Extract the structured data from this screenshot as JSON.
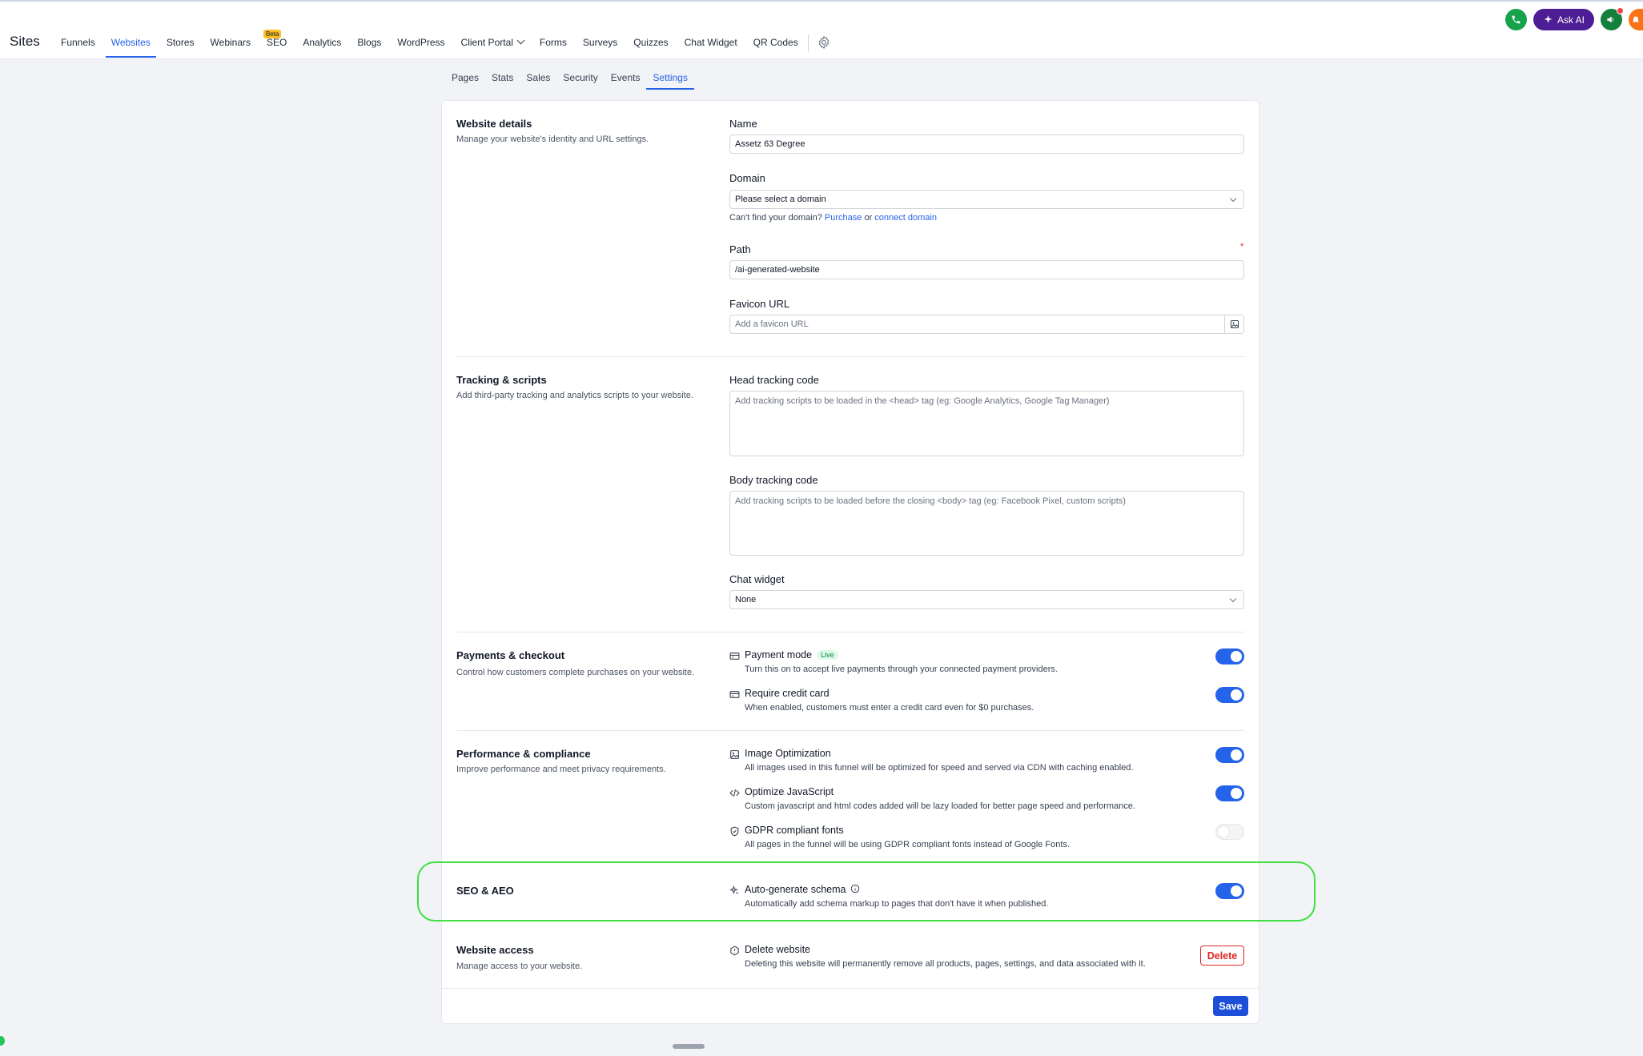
{
  "app": {
    "title": "Sites"
  },
  "nav": [
    {
      "label": "Funnels"
    },
    {
      "label": "Websites",
      "active": true
    },
    {
      "label": "Stores"
    },
    {
      "label": "Webinars"
    },
    {
      "label": "SEO",
      "badge": "Beta"
    },
    {
      "label": "Analytics"
    },
    {
      "label": "Blogs"
    },
    {
      "label": "WordPress"
    },
    {
      "label": "Client Portal",
      "dropdown": true
    },
    {
      "label": "Forms"
    },
    {
      "label": "Surveys"
    },
    {
      "label": "Quizzes"
    },
    {
      "label": "Chat Widget"
    },
    {
      "label": "QR Codes"
    }
  ],
  "topright": {
    "ask_ai": "Ask AI",
    "phone_color": "#16a34a",
    "ask_ai_color": "#4c1d95",
    "notif_color": "#f97316"
  },
  "subtabs": [
    {
      "label": "Pages"
    },
    {
      "label": "Stats"
    },
    {
      "label": "Sales"
    },
    {
      "label": "Security"
    },
    {
      "label": "Events"
    },
    {
      "label": "Settings",
      "active": true
    }
  ],
  "website_details": {
    "title": "Website details",
    "desc": "Manage your website's identity and URL settings.",
    "name_label": "Name",
    "name_value": "Assetz 63 Degree",
    "domain_label": "Domain",
    "domain_value": "Please select a domain",
    "domain_hint_prefix": "Can't find your domain?",
    "domain_hint_purchase": "Purchase",
    "domain_hint_or": "or",
    "domain_hint_connect": "connect domain",
    "path_label": "Path",
    "path_required": "*",
    "path_value": "/ai-generated-website",
    "favicon_label": "Favicon URL",
    "favicon_placeholder": "Add a favicon URL"
  },
  "tracking": {
    "title": "Tracking & scripts",
    "desc": "Add third-party tracking and analytics scripts to your website.",
    "head_label": "Head tracking code",
    "head_placeholder": "Add tracking scripts to be loaded in the <head> tag (eg: Google Analytics, Google Tag Manager)",
    "body_label": "Body tracking code",
    "body_placeholder": "Add tracking scripts to be loaded before the closing <body> tag (eg: Facebook Pixel, custom scripts)",
    "chat_label": "Chat widget",
    "chat_value": "None"
  },
  "payments": {
    "title": "Payments & checkout",
    "desc": "Control how customers complete purchases on your website.",
    "options": [
      {
        "title": "Payment mode",
        "badge": "Live",
        "desc": "Turn this on to accept live payments through your connected payment providers.",
        "enabled": true,
        "icon": "credit-card-icon"
      },
      {
        "title": "Require credit card",
        "desc": "When enabled, customers must enter a credit card even for $0 purchases.",
        "enabled": true,
        "icon": "credit-card-icon"
      }
    ]
  },
  "performance": {
    "title": "Performance & compliance",
    "desc": "Improve performance and meet privacy requirements.",
    "options": [
      {
        "title": "Image Optimization",
        "desc": "All images used in this funnel will be optimized for speed and served via CDN with caching enabled.",
        "enabled": true,
        "icon": "image-icon"
      },
      {
        "title": "Optimize JavaScript",
        "desc": "Custom javascript and html codes added will be lazy loaded for better page speed and performance.",
        "enabled": true,
        "icon": "code-icon"
      },
      {
        "title": "GDPR compliant fonts",
        "desc": "All pages in the funnel will be using GDPR compliant fonts instead of Google Fonts.",
        "enabled": false,
        "icon": "shield-icon"
      }
    ]
  },
  "seo": {
    "title": "SEO & AEO",
    "option": {
      "title": "Auto-generate schema",
      "desc": "Automatically add schema markup to pages that don't have it when published.",
      "enabled": true,
      "icon": "sparkle-icon"
    }
  },
  "access": {
    "title": "Website access",
    "desc": "Manage access to your website.",
    "option": {
      "title": "Delete website",
      "desc": "Deleting this website will permanently remove all products, pages, settings, and data associated with it.",
      "icon": "delete-website-icon"
    },
    "delete_label": "Delete"
  },
  "footer": {
    "save_label": "Save"
  }
}
